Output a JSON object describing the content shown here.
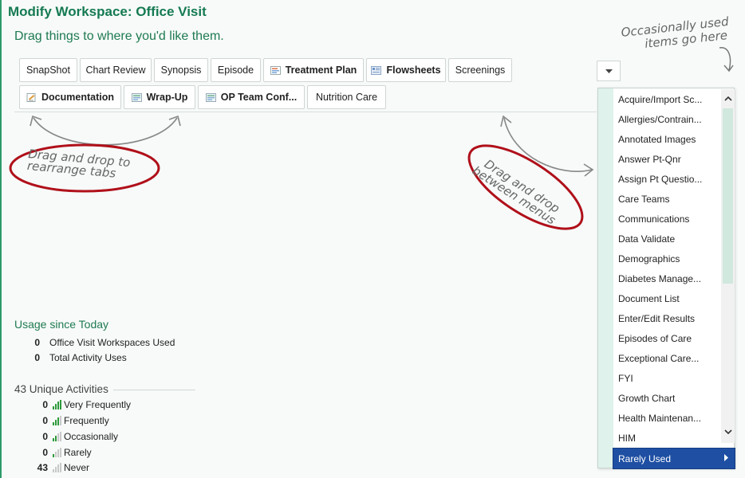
{
  "title": "Modify Workspace: Office Visit",
  "subtitle": "Drag things to where you'd like them.",
  "tabs_row1": [
    {
      "label": "SnapShot",
      "icon": null,
      "bold": false
    },
    {
      "label": "Chart Review",
      "icon": null,
      "bold": false
    },
    {
      "label": "Synopsis",
      "icon": null,
      "bold": false
    },
    {
      "label": "Episode",
      "icon": null,
      "bold": false
    },
    {
      "label": "Treatment Plan",
      "icon": "treatment-plan-icon",
      "bold": true
    },
    {
      "label": "Flowsheets",
      "icon": "flowsheets-icon",
      "bold": true
    },
    {
      "label": "Screenings",
      "icon": null,
      "bold": false
    }
  ],
  "tabs_row2": [
    {
      "label": "Documentation",
      "icon": "documentation-icon",
      "bold": true
    },
    {
      "label": "Wrap-Up",
      "icon": "wrap-up-icon",
      "bold": true
    },
    {
      "label": "OP Team Conf...",
      "icon": "op-team-conf-icon",
      "bold": true
    },
    {
      "label": "Nutrition Care",
      "icon": null,
      "bold": false
    }
  ],
  "annotations": {
    "occasional_line1": "Occasionally used",
    "occasional_line2": "items go here",
    "rearrange_line1": "Drag and drop to",
    "rearrange_line2": "rearrange tabs",
    "between_line1": "Drag and drop",
    "between_line2": "between menus"
  },
  "menu": {
    "items": [
      {
        "label": "Acquire/Import Sc...",
        "submenu": false
      },
      {
        "label": "Allergies/Contrain...",
        "submenu": false
      },
      {
        "label": "Annotated Images",
        "submenu": false
      },
      {
        "label": "Answer Pt-Qnr",
        "submenu": false
      },
      {
        "label": "Assign Pt Questio...",
        "submenu": false
      },
      {
        "label": "Care Teams",
        "submenu": false
      },
      {
        "label": "Communications",
        "submenu": false
      },
      {
        "label": "Data Validate",
        "submenu": true
      },
      {
        "label": "Demographics",
        "submenu": false
      },
      {
        "label": "Diabetes Manage...",
        "submenu": false
      },
      {
        "label": "Document List",
        "submenu": false
      },
      {
        "label": "Enter/Edit Results",
        "submenu": false
      },
      {
        "label": "Episodes of Care",
        "submenu": false
      },
      {
        "label": "Exceptional Care...",
        "submenu": false
      },
      {
        "label": "FYI",
        "submenu": false
      },
      {
        "label": "Growth Chart",
        "submenu": false
      },
      {
        "label": "Health Maintenan...",
        "submenu": false
      },
      {
        "label": "HIM",
        "submenu": true
      }
    ],
    "selected": {
      "label": "Rarely Used",
      "submenu": true
    }
  },
  "usage": {
    "title": "Usage since Today",
    "rows": [
      {
        "num": "0",
        "label": "Office Visit Workspaces Used"
      },
      {
        "num": "0",
        "label": "Total Activity Uses"
      }
    ]
  },
  "unique": {
    "title": "43 Unique Activities",
    "rows": [
      {
        "num": "0",
        "label": "Very Frequently",
        "level": 4
      },
      {
        "num": "0",
        "label": "Frequently",
        "level": 3
      },
      {
        "num": "0",
        "label": "Occasionally",
        "level": 2
      },
      {
        "num": "0",
        "label": "Rarely",
        "level": 1
      },
      {
        "num": "43",
        "label": "Never",
        "level": 0
      }
    ]
  },
  "colors": {
    "accent": "#157a52",
    "annotation_circle": "#b0101a",
    "selected_bg": "#1e4fa3",
    "bar_on": "#2e9a3a",
    "bar_off": "#c9c9c9"
  }
}
